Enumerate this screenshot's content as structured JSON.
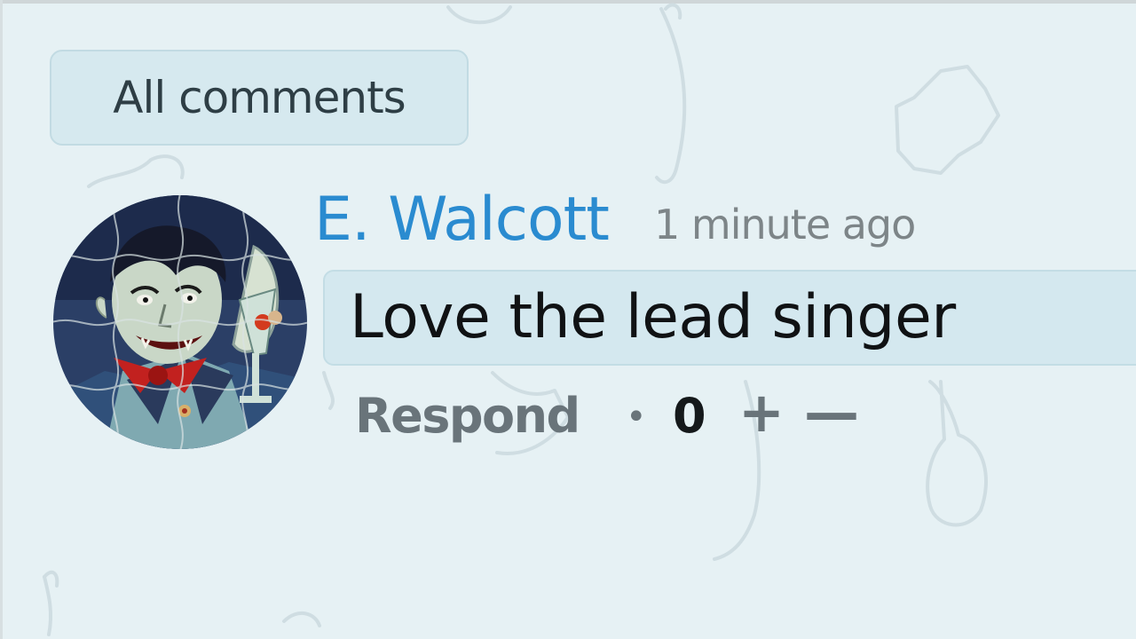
{
  "filter": {
    "label": "All comments"
  },
  "comment": {
    "author": "E. Walcott",
    "timestamp": "1 minute ago",
    "text": "Love the lead singer",
    "avatar_icon": "vampire-avatar-icon",
    "actions": {
      "respond_label": "Respond",
      "separator": "•",
      "score": "0",
      "upvote_label": "+",
      "downvote_label": "—"
    }
  },
  "colors": {
    "background": "#e6f1f4",
    "author": "#2a8bd0",
    "muted": "#7d8588",
    "box": "#d4e8ef"
  }
}
